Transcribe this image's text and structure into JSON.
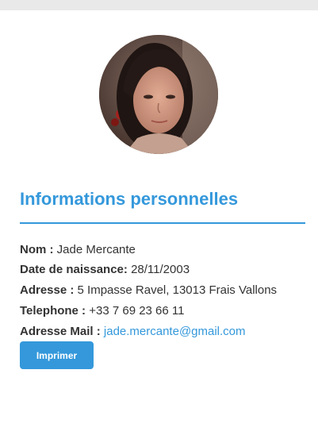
{
  "profile": {
    "photo_alt": "Photo de profil",
    "section_title": "Informations personnelles",
    "fields": [
      {
        "label": "Nom :",
        "value": "Jade Mercante"
      },
      {
        "label": "Date de naissance:",
        "value": "28/11/2003"
      },
      {
        "label": "Adresse :",
        "value": "5 Impasse Ravel, 13013 Frais Vallons"
      },
      {
        "label": "Telephone :",
        "value": "+33 7 69 23 66 11"
      },
      {
        "label": "Adresse Mail :",
        "value": "jade.mercante@gmail.com"
      }
    ],
    "print_button": "Imprimer"
  },
  "colors": {
    "accent": "#3498db",
    "text": "#333333",
    "background": "#ffffff"
  }
}
